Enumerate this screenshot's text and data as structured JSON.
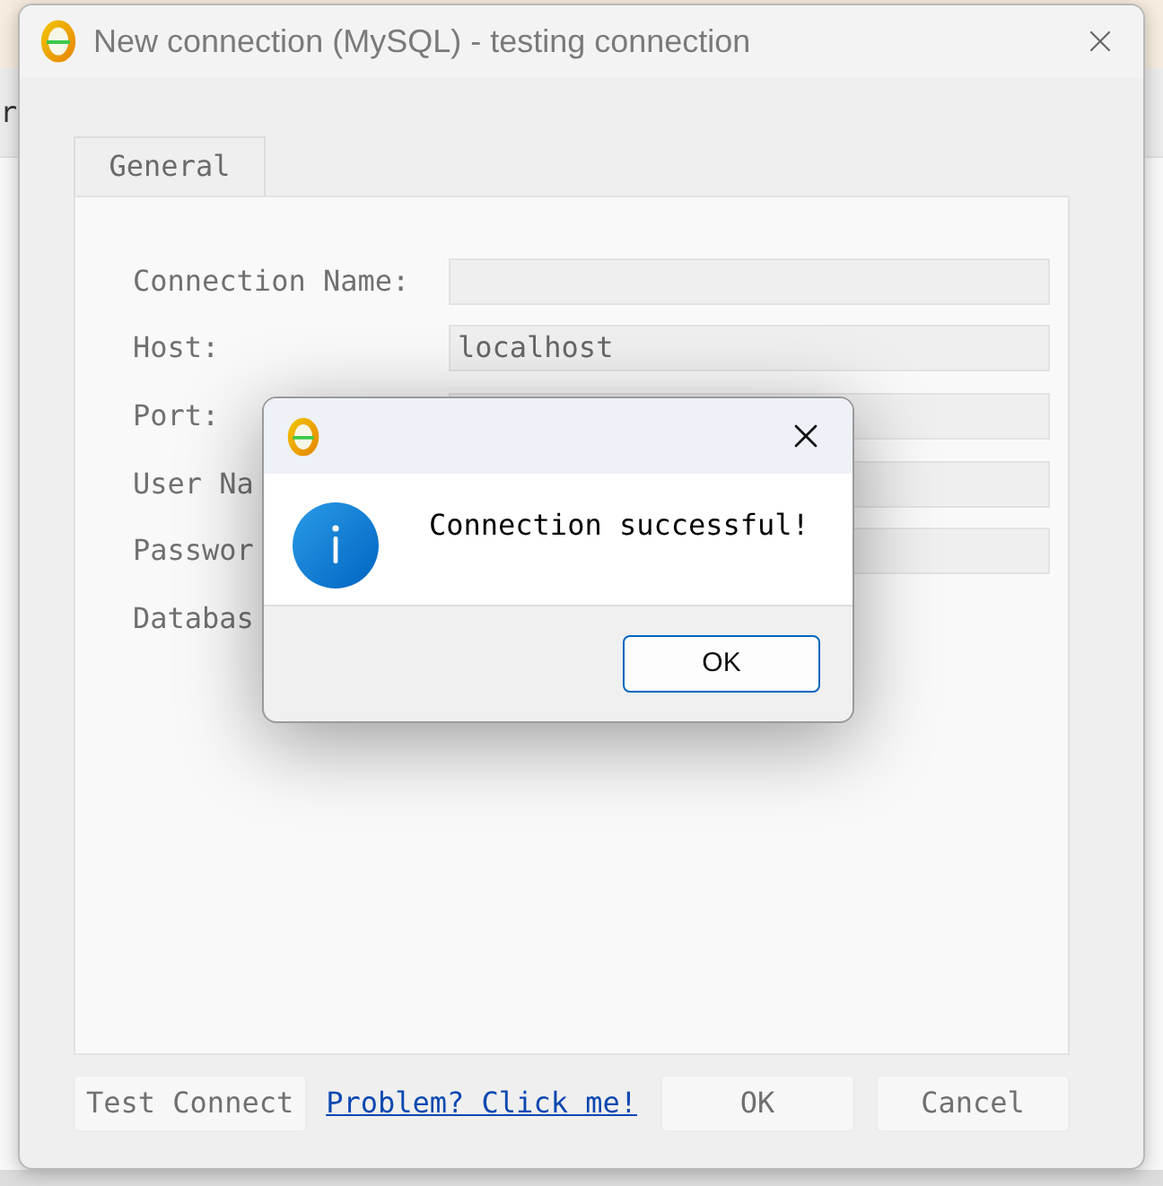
{
  "background": {
    "text": "r"
  },
  "window": {
    "title": "New connection (MySQL) - testing connection",
    "tabs": [
      {
        "label": "General",
        "selected": true
      }
    ]
  },
  "form": {
    "rows": [
      {
        "kind": "input",
        "label": "Connection Name:"
      },
      {
        "kind": "input",
        "label": "Host:",
        "value": "localhost"
      },
      {
        "kind": "input",
        "label": "Port:"
      },
      {
        "kind": "input",
        "label": "User Na"
      },
      {
        "kind": "input",
        "label": "Passwor"
      },
      {
        "kind": "label",
        "label": "Databas"
      }
    ]
  },
  "buttons": [
    {
      "kind": "button",
      "label": "Test Connect"
    },
    {
      "kind": "link",
      "label": "Problem? Click me!"
    },
    {
      "kind": "button",
      "label": "OK"
    },
    {
      "kind": "button",
      "label": "Cancel"
    }
  ],
  "message_box": {
    "message": "Connection successful!",
    "buttons": [
      {
        "label": "OK",
        "default": true
      }
    ]
  }
}
